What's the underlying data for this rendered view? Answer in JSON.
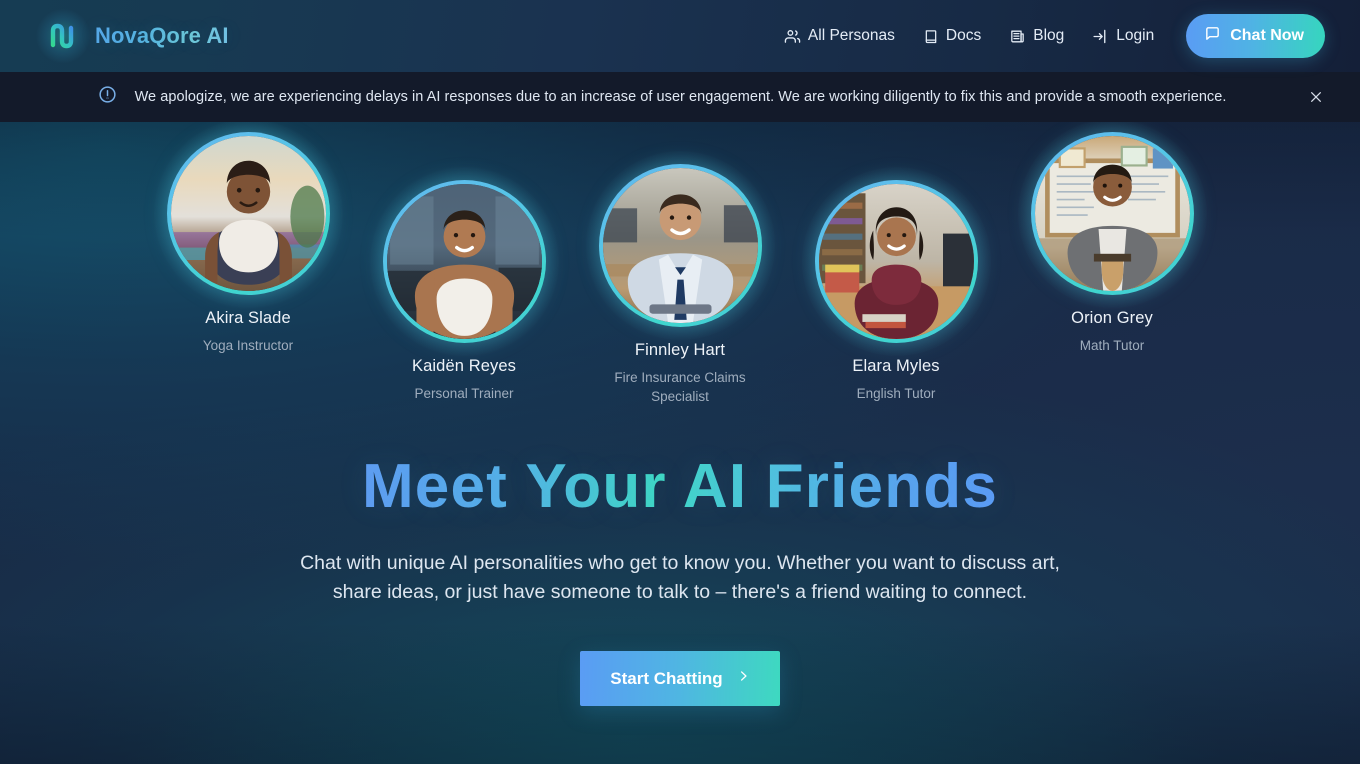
{
  "header": {
    "brand_name": "NovaQore AI",
    "logo_icon": "wave-logo-icon",
    "nav": [
      {
        "label": "All Personas",
        "icon": "users-icon"
      },
      {
        "label": "Docs",
        "icon": "book-icon"
      },
      {
        "label": "Blog",
        "icon": "newspaper-icon"
      },
      {
        "label": "Login",
        "icon": "login-arrow-icon"
      }
    ],
    "chat_now": {
      "label": "Chat Now",
      "icon": "chat-bubble-icon"
    }
  },
  "alert": {
    "icon": "exclamation-circle-icon",
    "message": "We apologize, we are experiencing delays in AI responses due to an increase of user engagement. We are working diligently to fix this and provide a smooth experience.",
    "close_icon": "close-icon"
  },
  "personas": [
    {
      "name": "Akira Slade",
      "role": "Yoga Instructor"
    },
    {
      "name": "Kaidën Reyes",
      "role": "Personal Trainer"
    },
    {
      "name": "Finnley Hart",
      "role": "Fire Insurance Claims Specialist"
    },
    {
      "name": "Elara Myles",
      "role": "English Tutor"
    },
    {
      "name": "Orion Grey",
      "role": "Math Tutor"
    }
  ],
  "hero": {
    "title": "Meet Your AI Friends",
    "subtitle": "Chat with unique AI personalities who get to know you. Whether you want to discuss art, share ideas, or just have someone to talk to – there's a friend waiting to connect.",
    "cta_label": "Start Chatting",
    "cta_icon": "chevron-right-icon"
  },
  "colors": {
    "accent_blue": "#5a9cf4",
    "accent_teal": "#3ed9c0",
    "ring_cyan": "#4ac6e0",
    "alert_bar_bg": "#131a2a",
    "header_bg": "#1a3250"
  }
}
